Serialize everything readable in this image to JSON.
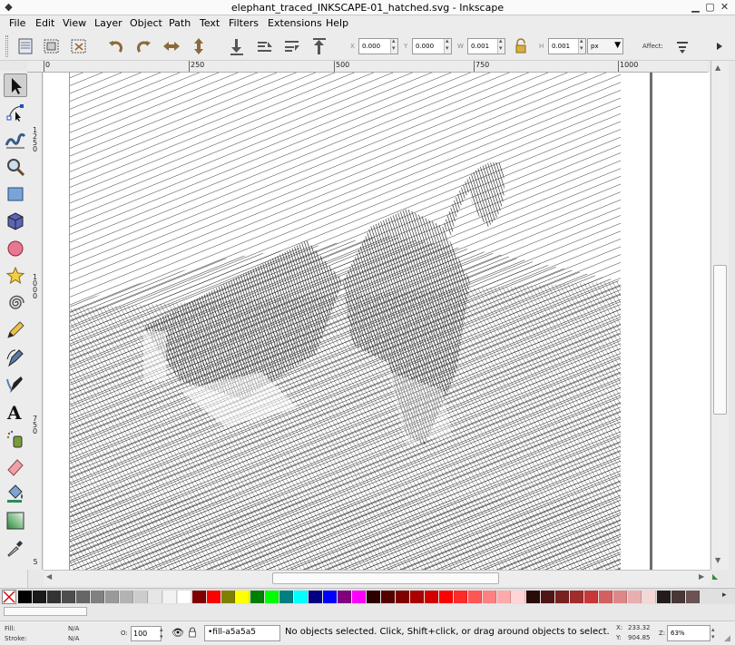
{
  "window": {
    "title": "elephant_traced_INKSCAPE-01_hatched.svg - Inkscape"
  },
  "menu": [
    "File",
    "Edit",
    "View",
    "Layer",
    "Object",
    "Path",
    "Text",
    "Filters",
    "Extensions",
    "Help"
  ],
  "coords": {
    "x_label": "X",
    "x_value": "0.000",
    "y_label": "Y",
    "y_value": "0.000",
    "w_label": "W",
    "w_value": "0.001",
    "h_label": "H",
    "h_value": "0.001",
    "unit": "px",
    "affect_label": "Affect:"
  },
  "ruler": {
    "h_labels": [
      "0",
      "250",
      "500",
      "750",
      "1000"
    ],
    "v_labels": [
      "1250",
      "1000",
      "750",
      "5"
    ]
  },
  "palette": {
    "colors": [
      "#000000",
      "#1a1a1a",
      "#333333",
      "#4d4d4d",
      "#666666",
      "#808080",
      "#999999",
      "#b3b3b3",
      "#cccccc",
      "#e6e6e6",
      "#f2f2f2",
      "#ffffff",
      "#800000",
      "#ff0000",
      "#808000",
      "#ffff00",
      "#008000",
      "#00ff00",
      "#008080",
      "#00ffff",
      "#000080",
      "#0000ff",
      "#800080",
      "#ff00ff",
      "#2b0000",
      "#550000",
      "#800000",
      "#aa0000",
      "#d40000",
      "#ff0000",
      "#ff2a2a",
      "#ff5555",
      "#ff8080",
      "#ffaaaa",
      "#ffd5d5",
      "#280b0b",
      "#501616",
      "#782121",
      "#a02c2c",
      "#c83737",
      "#d35f5f",
      "#de8787",
      "#e9afaf",
      "#f4d7d7",
      "#241c1c",
      "#483737",
      "#6c5353"
    ]
  },
  "status": {
    "fill_label": "Fill:",
    "fill_value": "N/A",
    "stroke_label": "Stroke:",
    "stroke_value": "N/A",
    "opacity_label": "O:",
    "opacity_value": "100",
    "layer": "•fill-a5a5a5",
    "message": "No objects selected. Click, Shift+click, or drag around objects to select.",
    "x_label": "X:",
    "x_value": "233.32",
    "y_label": "Y:",
    "y_value": "904.85",
    "zoom_label": "Z:",
    "zoom_value": "63%"
  }
}
